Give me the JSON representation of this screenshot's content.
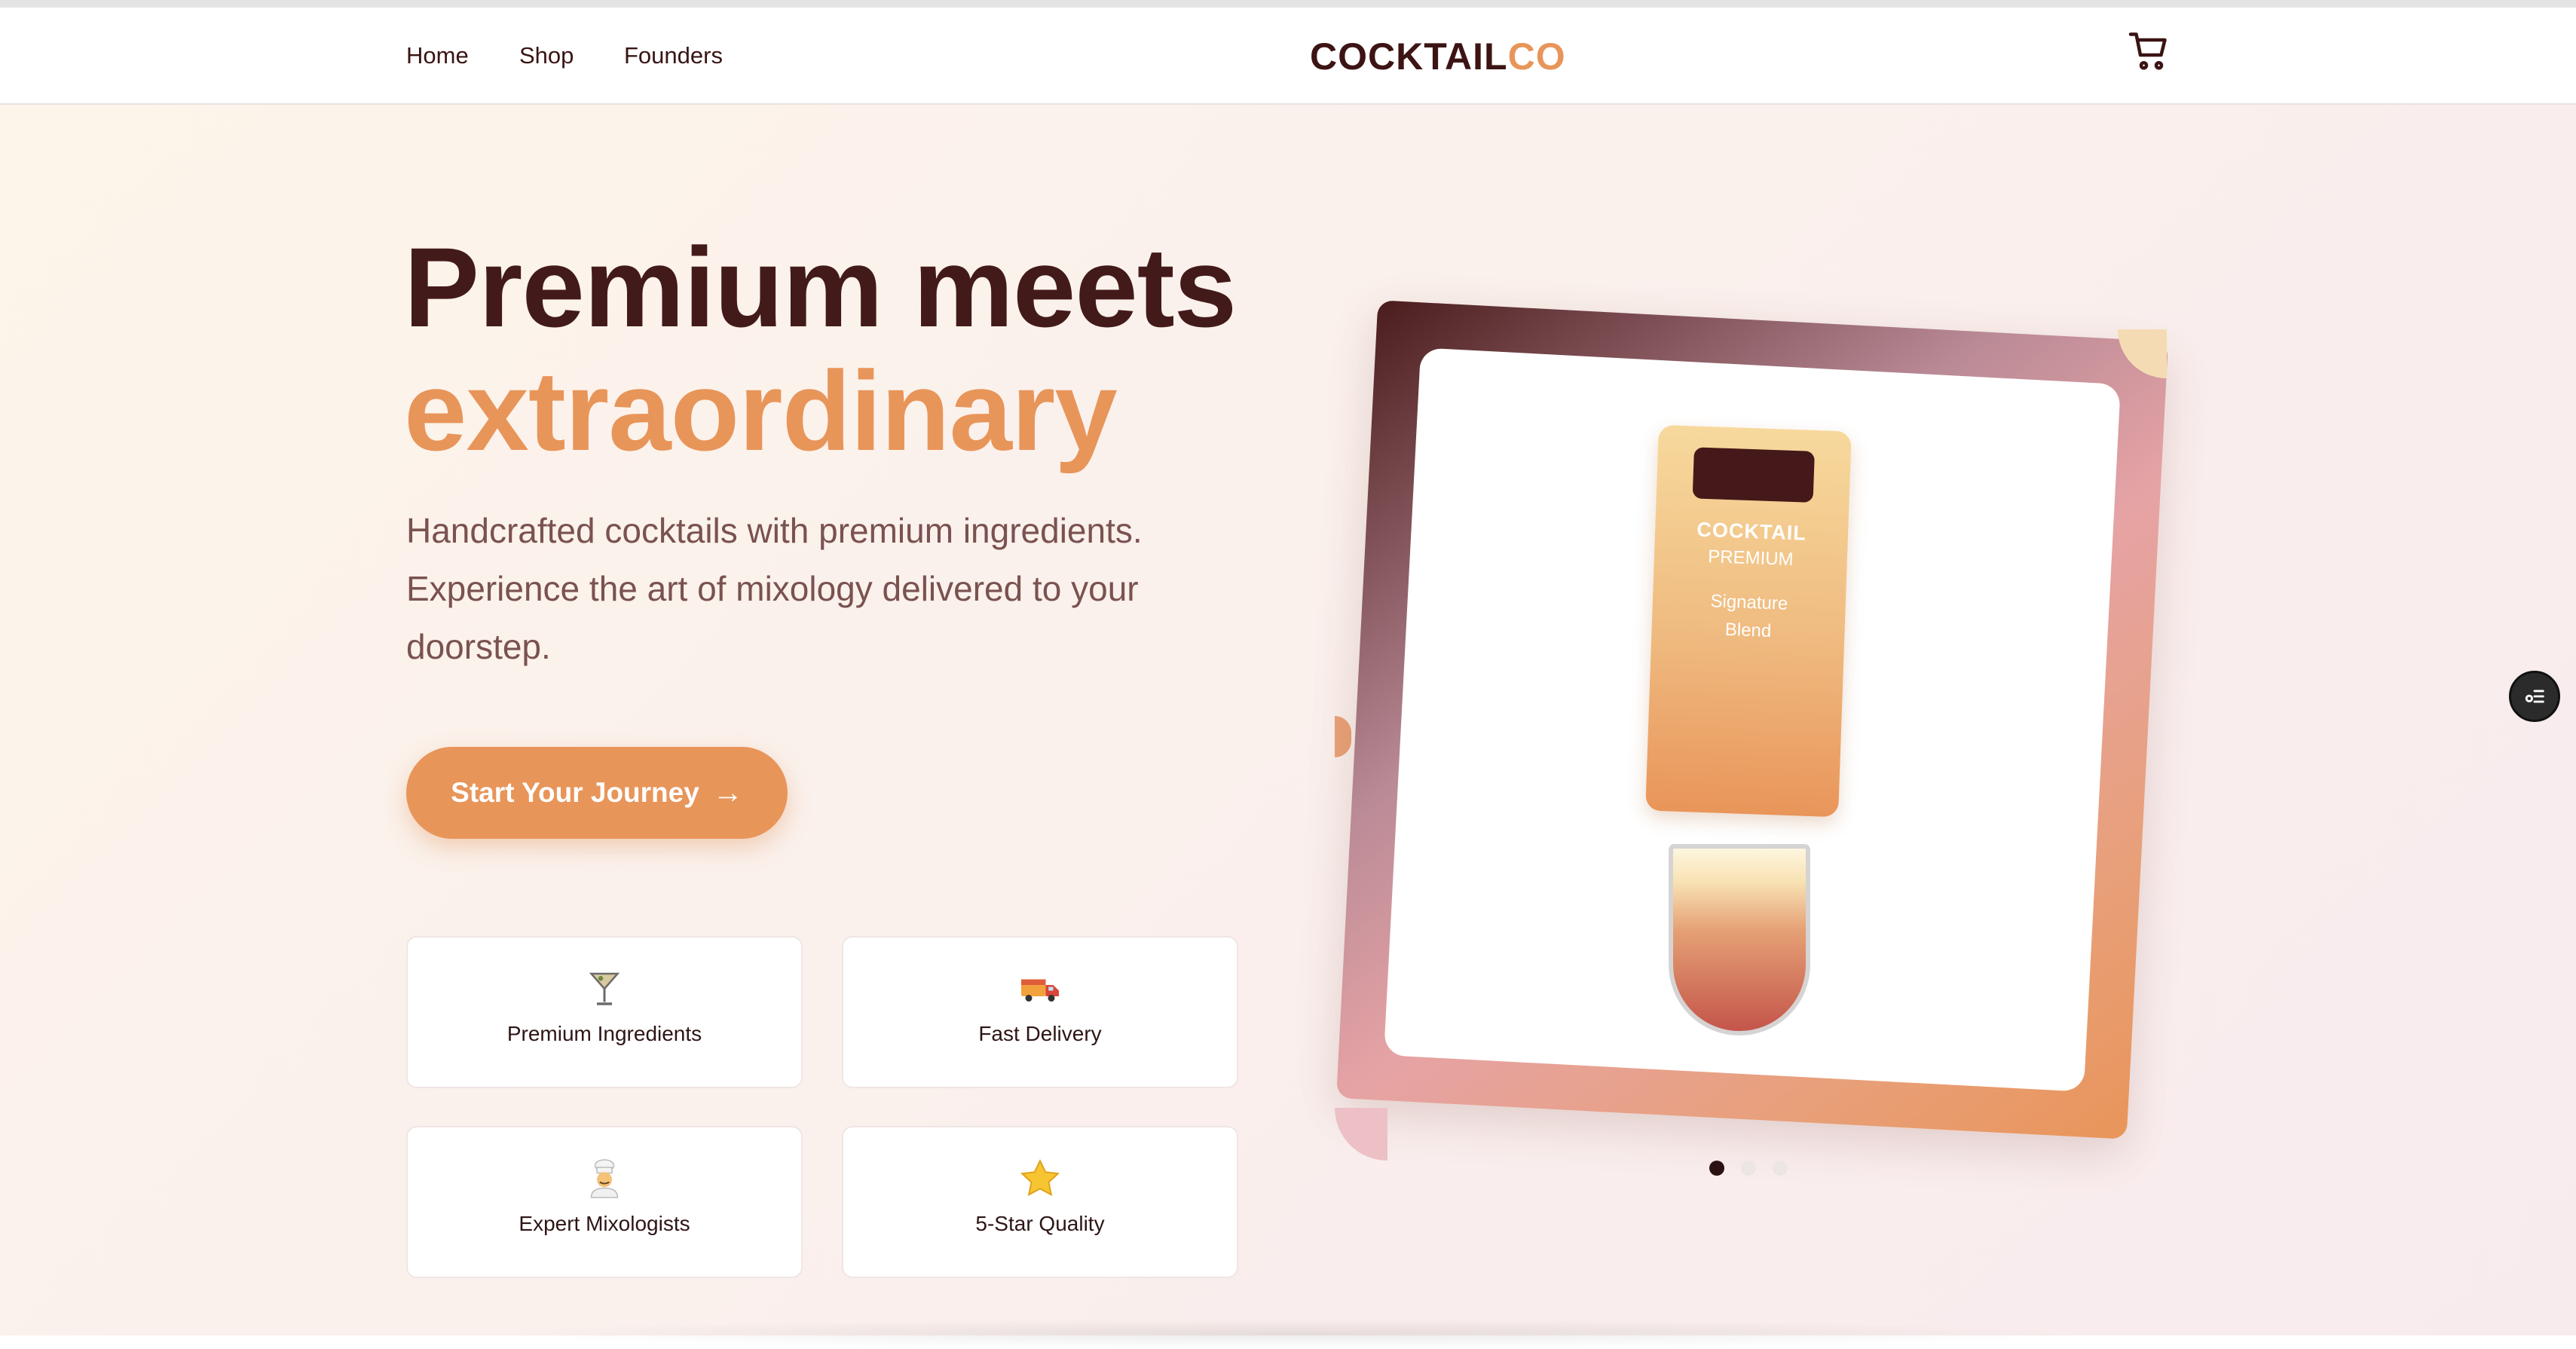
{
  "nav": {
    "links": [
      "Home",
      "Shop",
      "Founders"
    ],
    "logo_main": "COCKTAIL",
    "logo_accent": "CO",
    "cart_icon": "shopping-cart-icon"
  },
  "hero": {
    "headline_line1": "Premium meets",
    "headline_line2": "extraordinary",
    "subtext": "Handcrafted cocktails with premium ingredients. Experience the art of mixology delivered to your doorstep.",
    "cta_label": "Start Your Journey",
    "cta_arrow": "→"
  },
  "features": [
    {
      "icon": "🍸",
      "icon_name": "cocktail-glass-icon",
      "label": "Premium Ingredients"
    },
    {
      "icon": "🚚",
      "icon_name": "delivery-truck-icon",
      "label": "Fast Delivery"
    },
    {
      "icon": "👨‍🍳",
      "icon_name": "chef-icon",
      "label": "Expert Mixologists"
    },
    {
      "icon": "⭐",
      "icon_name": "star-icon",
      "label": "5-Star Quality"
    }
  ],
  "showcase": {
    "bottle_title": "COCKTAIL",
    "bottle_subtitle": "PREMIUM",
    "bottle_line1": "Signature",
    "bottle_line2": "Blend",
    "slides_total": 3,
    "active_slide": 1
  },
  "colors": {
    "brand_dark": "#431a1a",
    "accent": "#e8955a",
    "text_muted": "#7a5250"
  }
}
